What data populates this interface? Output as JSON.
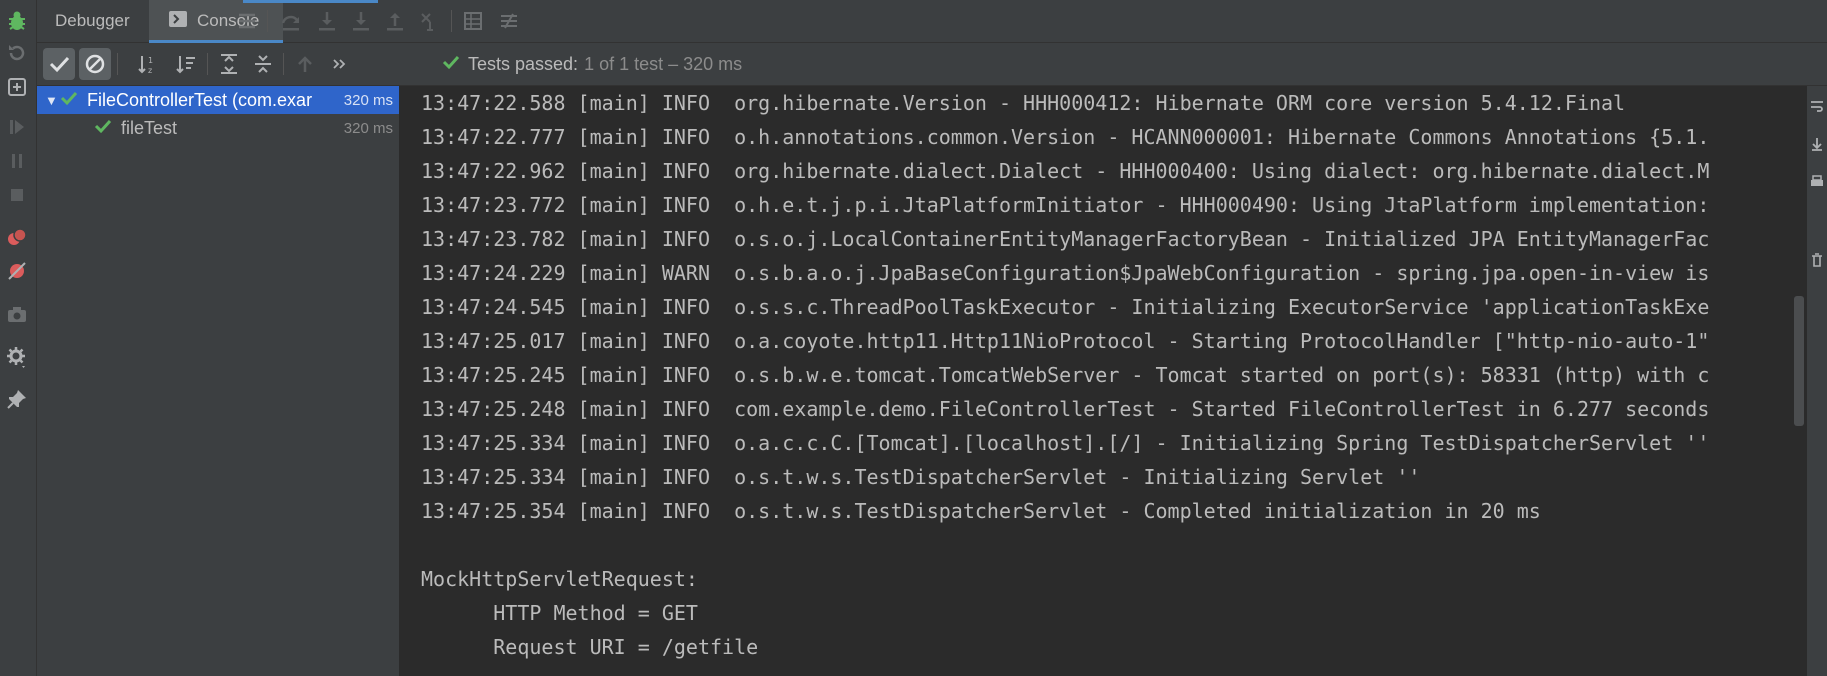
{
  "colors": {
    "panel": "#3c3f41",
    "editor": "#2b2b2b",
    "accent_blue": "#4a88c7",
    "selection": "#2f65ca",
    "success_green": "#5fb760"
  },
  "tabs": {
    "debugger_label": "Debugger",
    "console_label": "Console"
  },
  "status": {
    "passed": "Tests passed:",
    "detail": "1 of 1 test – 320 ms"
  },
  "tree": {
    "root": {
      "label": "FileControllerTest (com.exar",
      "duration": "320 ms"
    },
    "child": {
      "label": "fileTest",
      "duration": "320 ms"
    }
  },
  "console": {
    "lines": [
      "13:47:22.588 [main] INFO  org.hibernate.Version - HHH000412: Hibernate ORM core version 5.4.12.Final",
      "13:47:22.777 [main] INFO  o.h.annotations.common.Version - HCANN000001: Hibernate Commons Annotations {5.1.",
      "13:47:22.962 [main] INFO  org.hibernate.dialect.Dialect - HHH000400: Using dialect: org.hibernate.dialect.M",
      "13:47:23.772 [main] INFO  o.h.e.t.j.p.i.JtaPlatformInitiator - HHH000490: Using JtaPlatform implementation:",
      "13:47:23.782 [main] INFO  o.s.o.j.LocalContainerEntityManagerFactoryBean - Initialized JPA EntityManagerFac",
      "13:47:24.229 [main] WARN  o.s.b.a.o.j.JpaBaseConfiguration$JpaWebConfiguration - spring.jpa.open-in-view is",
      "13:47:24.545 [main] INFO  o.s.s.c.ThreadPoolTaskExecutor - Initializing ExecutorService 'applicationTaskExe",
      "13:47:25.017 [main] INFO  o.a.coyote.http11.Http11NioProtocol - Starting ProtocolHandler [\"http-nio-auto-1\"",
      "13:47:25.245 [main] INFO  o.s.b.w.e.tomcat.TomcatWebServer - Tomcat started on port(s): 58331 (http) with c",
      "13:47:25.248 [main] INFO  com.example.demo.FileControllerTest - Started FileControllerTest in 6.277 seconds",
      "13:47:25.334 [main] INFO  o.a.c.c.C.[Tomcat].[localhost].[/] - Initializing Spring TestDispatcherServlet ''",
      "13:47:25.334 [main] INFO  o.s.t.w.s.TestDispatcherServlet - Initializing Servlet ''",
      "13:47:25.354 [main] INFO  o.s.t.w.s.TestDispatcherServlet - Completed initialization in 20 ms",
      "",
      "MockHttpServletRequest:",
      "      HTTP Method = GET",
      "      Request URI = /getfile"
    ]
  },
  "icons": {
    "left_strip": [
      "debug-bug-icon",
      "rerun-icon",
      "restore-layout-icon",
      "resume-icon",
      "pause-icon",
      "stop-icon",
      "view-breakpoints-icon",
      "mute-breakpoints-icon",
      "camera-icon",
      "settings-icon",
      "pin-icon"
    ],
    "toolbar": [
      "show-passed-icon",
      "show-ignored-icon",
      "sort-alpha-icon",
      "sort-duration-icon",
      "expand-all-icon",
      "collapse-all-icon",
      "previous-failed-icon",
      "more-icon"
    ]
  }
}
